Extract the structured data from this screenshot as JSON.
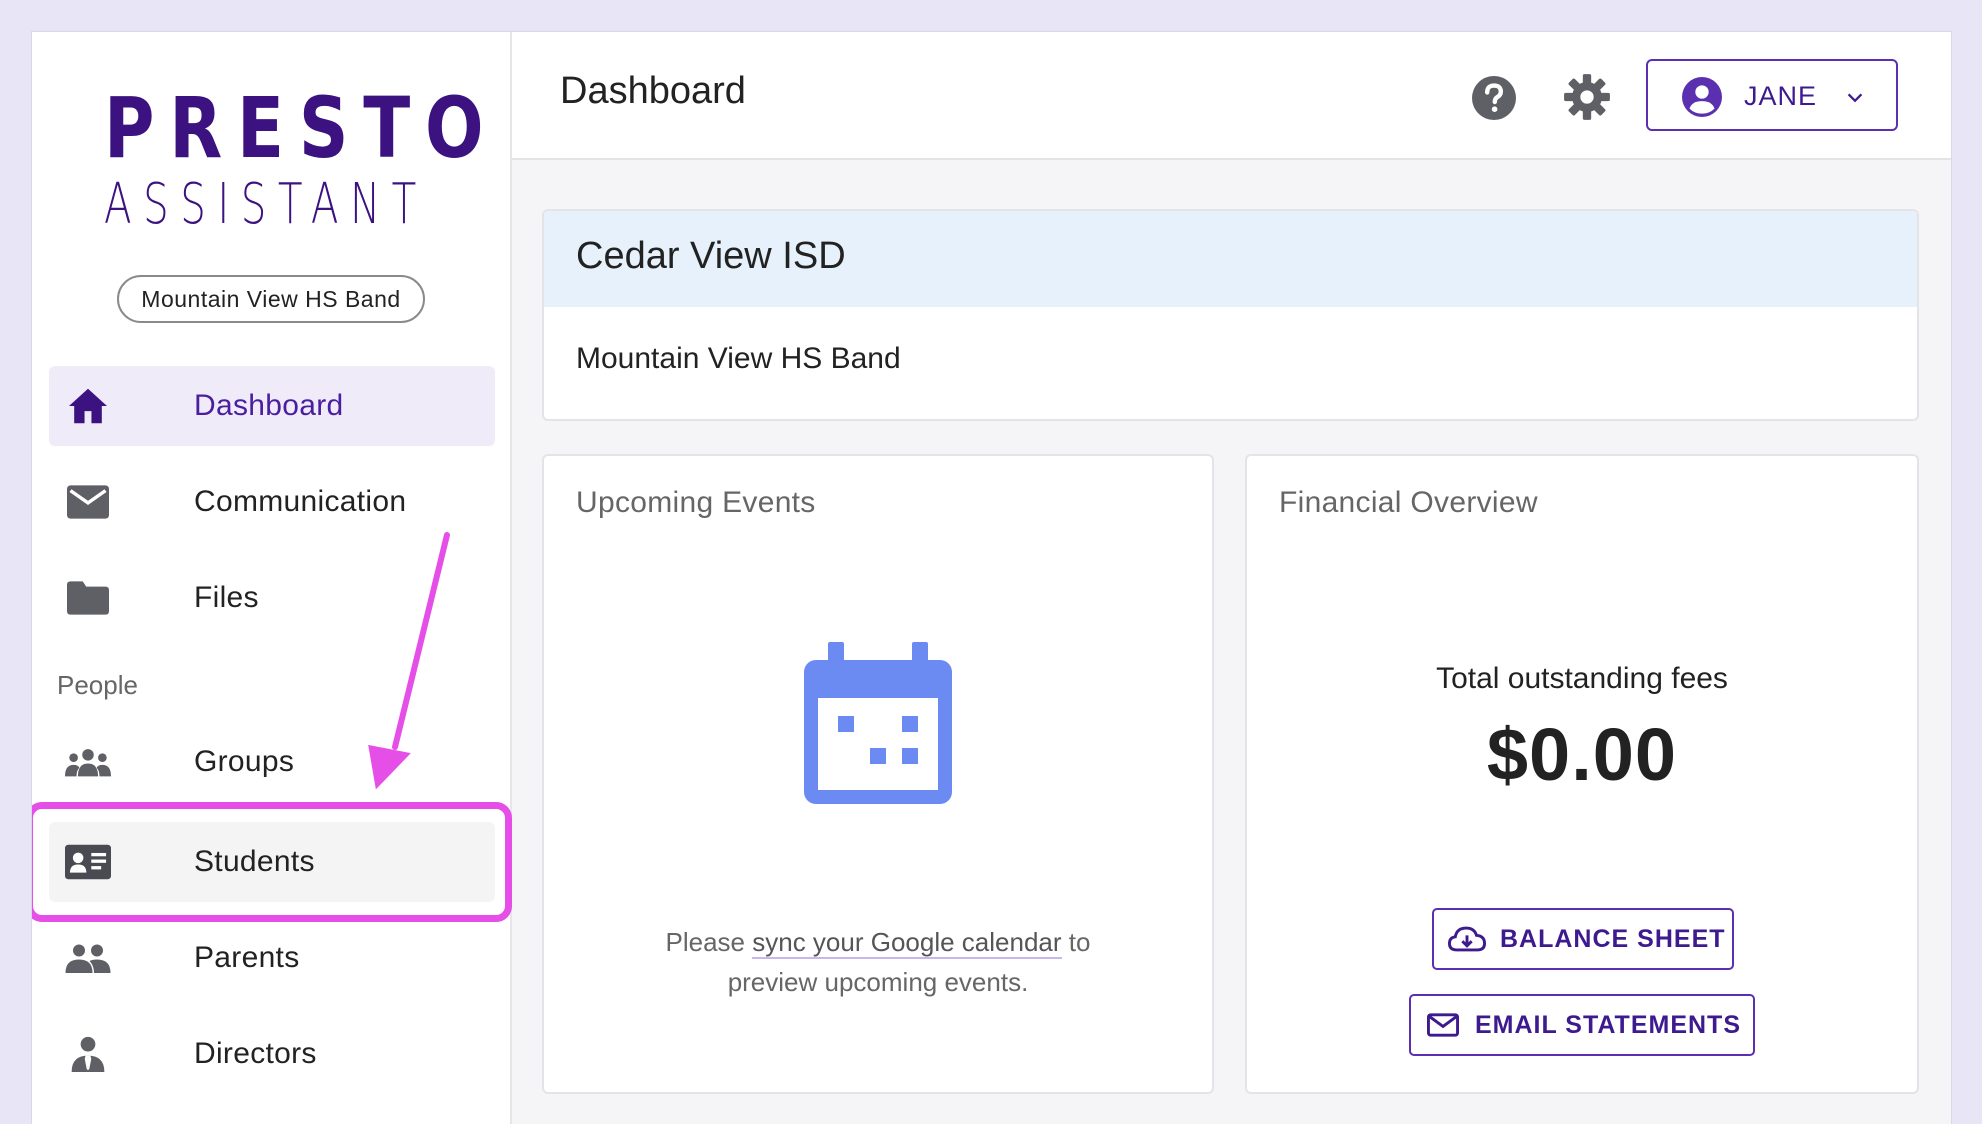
{
  "brand": {
    "logo_line1": "PRESTO",
    "logo_line2": "ASSISTANT",
    "color": "#3c1280"
  },
  "sidebar": {
    "org_pill": "Mountain View HS Band",
    "items": [
      {
        "label": "Dashboard",
        "icon": "home-icon",
        "state": "active"
      },
      {
        "label": "Communication",
        "icon": "mail-icon"
      },
      {
        "label": "Files",
        "icon": "folder-icon"
      },
      {
        "label": "Groups",
        "icon": "groups-icon"
      },
      {
        "label": "Students",
        "icon": "id-card-icon",
        "state": "highlighted"
      },
      {
        "label": "Parents",
        "icon": "people-icon"
      },
      {
        "label": "Directors",
        "icon": "director-icon"
      }
    ],
    "section_people": "People",
    "highlight_color": "#e54fe8"
  },
  "header": {
    "title": "Dashboard",
    "help_icon": "help-icon",
    "settings_icon": "gear-icon",
    "user": {
      "name": "JANE",
      "icon": "account-circle-icon"
    }
  },
  "org_card": {
    "district": "Cedar View ISD",
    "organization": "Mountain View HS Band"
  },
  "events_card": {
    "title": "Upcoming Events",
    "icon": "calendar-icon",
    "message_prefix": "Please ",
    "message_link": "sync your Google calendar",
    "message_suffix": " to",
    "message_line2": "preview upcoming events."
  },
  "financial_card": {
    "title": "Financial Overview",
    "label": "Total outstanding fees",
    "value": "$0.00",
    "balance_button": "BALANCE SHEET",
    "email_button": "EMAIL STATEMENTS"
  },
  "colors": {
    "accent": "#5b30b0",
    "calendar": "#6b8af2",
    "org_header_bg": "#e6f1fc"
  }
}
